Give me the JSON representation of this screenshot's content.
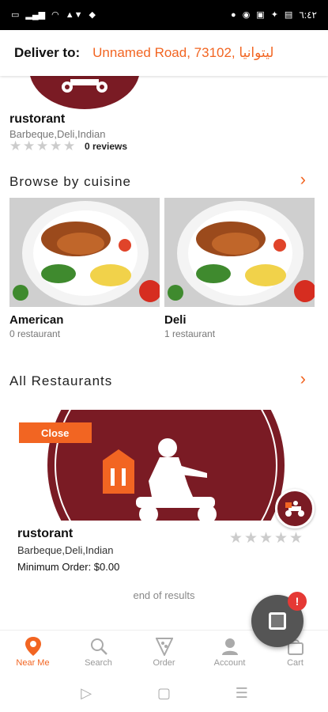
{
  "status_bar": {
    "right_text": "٦:٤٢"
  },
  "header": {
    "deliver_label": "Deliver to:",
    "address": "Unnamed Road, 73102, ليتوانيا"
  },
  "featured_restaurant": {
    "name": "rustorant",
    "cuisine": "Barbeque,Deli,Indian",
    "reviews": "0 reviews",
    "rating": 0
  },
  "browse": {
    "title": "Browse by cuisine",
    "cuisines": [
      {
        "name": "American",
        "count": "0 restaurant"
      },
      {
        "name": "Deli",
        "count": "1 restaurant"
      }
    ]
  },
  "all_restaurants": {
    "title": "All Restaurants",
    "items": [
      {
        "status": "Close",
        "name": "rustorant",
        "cuisine": "Barbeque,Deli,Indian",
        "min_order": "Minimum Order: $0.00",
        "rating": 0
      }
    ],
    "end_text": "end of results"
  },
  "fab": {
    "badge": "!"
  },
  "bottom_nav": [
    {
      "label": "Near Me",
      "icon": "location-pin-icon",
      "active": true
    },
    {
      "label": "Search",
      "icon": "search-icon",
      "active": false
    },
    {
      "label": "Order",
      "icon": "pizza-icon",
      "active": false
    },
    {
      "label": "Account",
      "icon": "account-icon",
      "active": false
    },
    {
      "label": "Cart",
      "icon": "cart-icon",
      "active": false
    }
  ],
  "colors": {
    "accent": "#f26522",
    "brand_logo": "#7a1b24",
    "badge_red": "#e53935"
  }
}
